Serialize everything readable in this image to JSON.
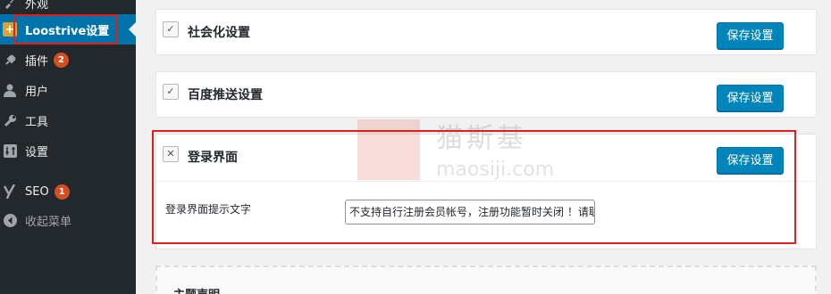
{
  "sidebar": {
    "items": [
      {
        "label": "外观",
        "icon": "brush-icon"
      },
      {
        "label": "Loostrive设置",
        "icon": "plus-icon"
      },
      {
        "label": "插件",
        "icon": "plugin-icon",
        "badge": "2"
      },
      {
        "label": "用户",
        "icon": "user-icon"
      },
      {
        "label": "工具",
        "icon": "wrench-icon"
      },
      {
        "label": "设置",
        "icon": "settings-icon"
      },
      {
        "label": "SEO",
        "icon": "yoast-icon",
        "badge": "1"
      },
      {
        "label": "收起菜单",
        "icon": "collapse-icon"
      }
    ]
  },
  "panels": {
    "social": {
      "title": "社会化设置",
      "toggle": "✓",
      "save_label": "保存设置"
    },
    "baidu": {
      "title": "百度推送设置",
      "toggle": "✓",
      "save_label": "保存设置"
    },
    "login": {
      "title": "登录界面",
      "toggle": "✕",
      "save_label": "保存设置",
      "field_label": "登录界面提示文字",
      "field_value": "不支持自行注册会员帐号，注册功能暂时关闭 ！请联系管理员"
    }
  },
  "theme_panel": {
    "title": "主题声明"
  },
  "watermark": {
    "cn": "猫斯基",
    "en": "maosiji.com"
  },
  "colors": {
    "accent": "#0085ba",
    "sidebar_bg": "#23282d",
    "annotation": "#e0201a",
    "badge": "#d54e21"
  }
}
